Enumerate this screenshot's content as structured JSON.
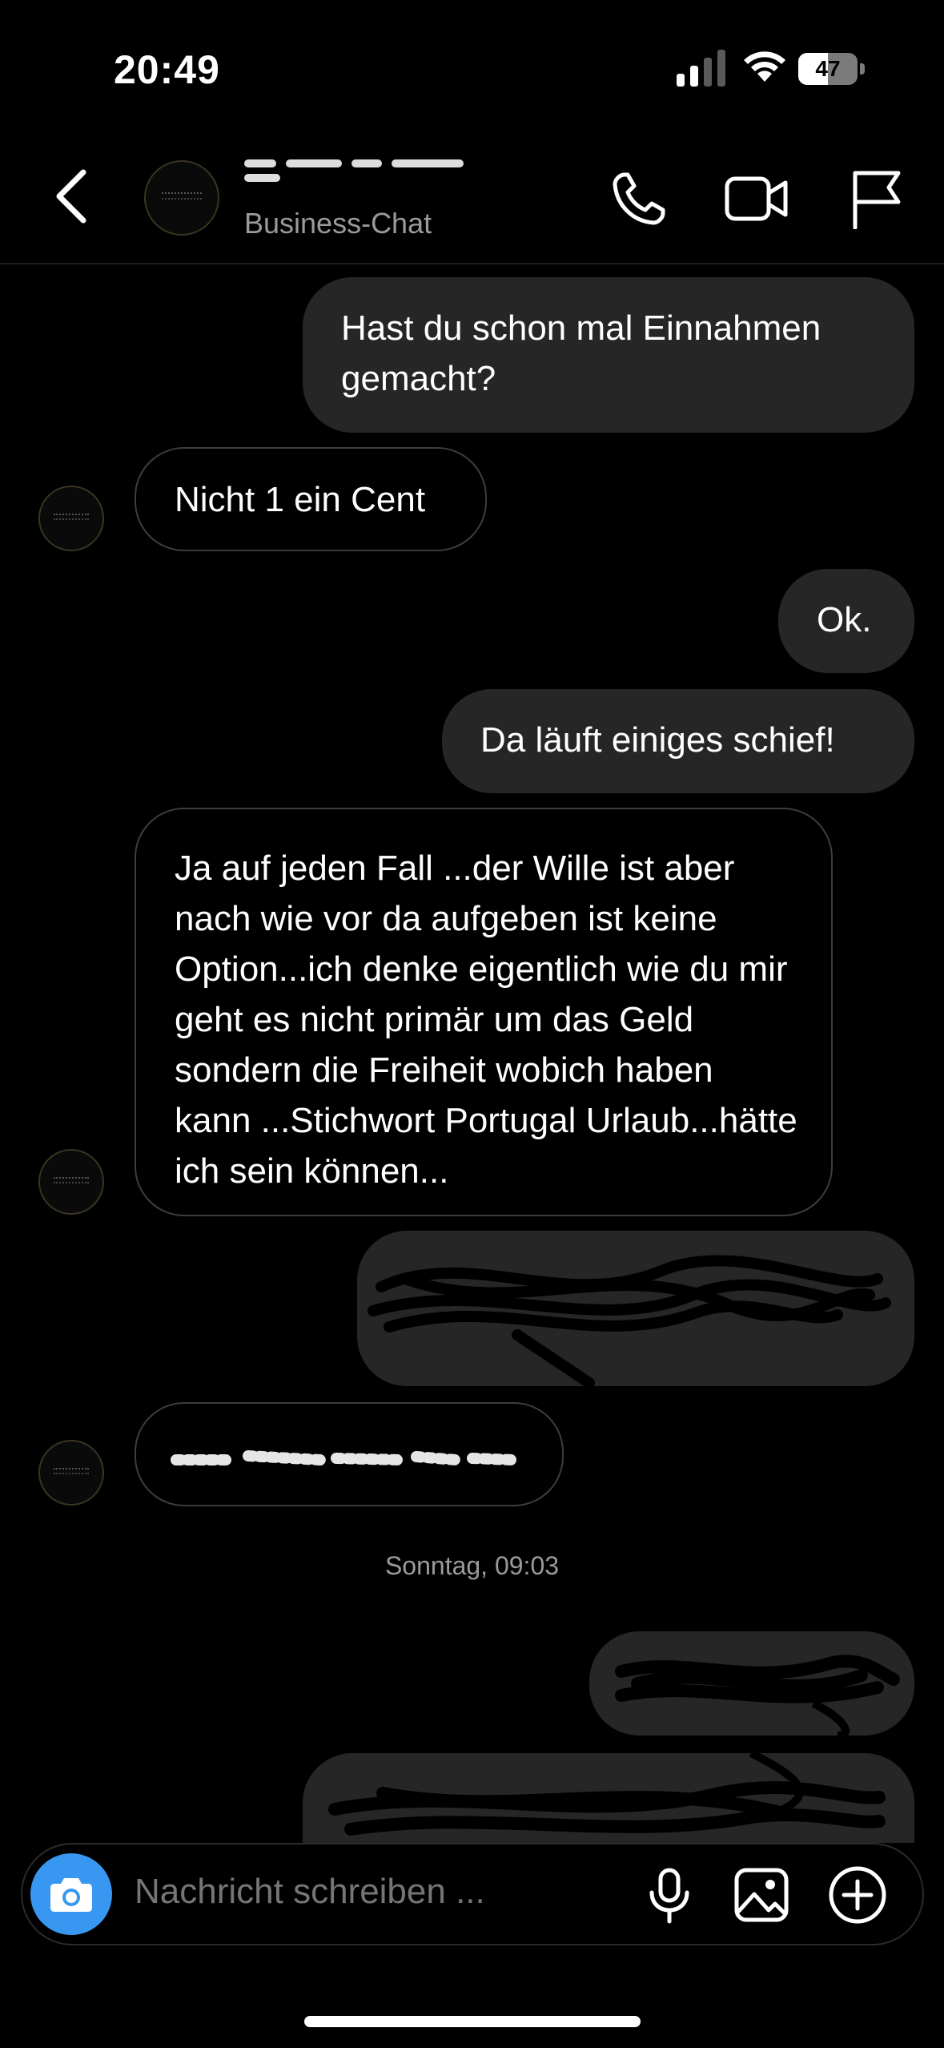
{
  "status_bar": {
    "time": "20:49",
    "battery": "47"
  },
  "header": {
    "name": "",
    "subtitle": "Business-Chat"
  },
  "messages": [
    {
      "side": "out",
      "text": "Hast du schon mal Einnahmen gemacht?"
    },
    {
      "side": "in",
      "text": "Nicht 1 ein Cent"
    },
    {
      "side": "out",
      "text": "Ok."
    },
    {
      "side": "out",
      "text": "Da läuft einiges schief!"
    },
    {
      "side": "in",
      "text": "Ja auf jeden Fall ...der Wille ist aber nach wie vor da aufgeben ist keine Option...ich denke eigentlich wie du mir geht es nicht primär um das Geld sondern die Freiheit wobich haben kann ...Stichwort Portugal Urlaub...hätte ich sein können..."
    },
    {
      "side": "out",
      "text": "[redacted]"
    },
    {
      "side": "in",
      "text": "[redacted]"
    },
    {
      "side": "out",
      "text": "[redacted]"
    },
    {
      "side": "out",
      "text": "[redacted]"
    }
  ],
  "date_separator": "Sonntag, 09:03",
  "composer": {
    "placeholder": "Nachricht schreiben ..."
  },
  "colors": {
    "background": "#000000",
    "outgoing_bubble": "#262626",
    "incoming_border": "#3d3d3d",
    "camera_button": "#3897f0"
  }
}
